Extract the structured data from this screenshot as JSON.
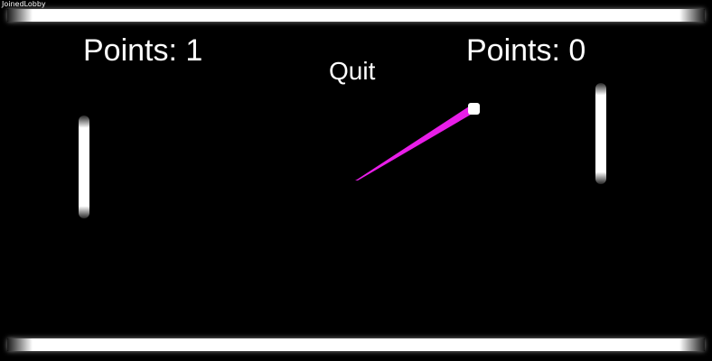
{
  "window": {
    "title": "JoinedLobby"
  },
  "scoreboard": {
    "left": "Points: 1",
    "right": "Points: 0"
  },
  "menu": {
    "quit_label": "Quit"
  },
  "colors": {
    "background": "#000000",
    "foreground": "#ffffff",
    "ball_trail": "#e81ee8"
  }
}
